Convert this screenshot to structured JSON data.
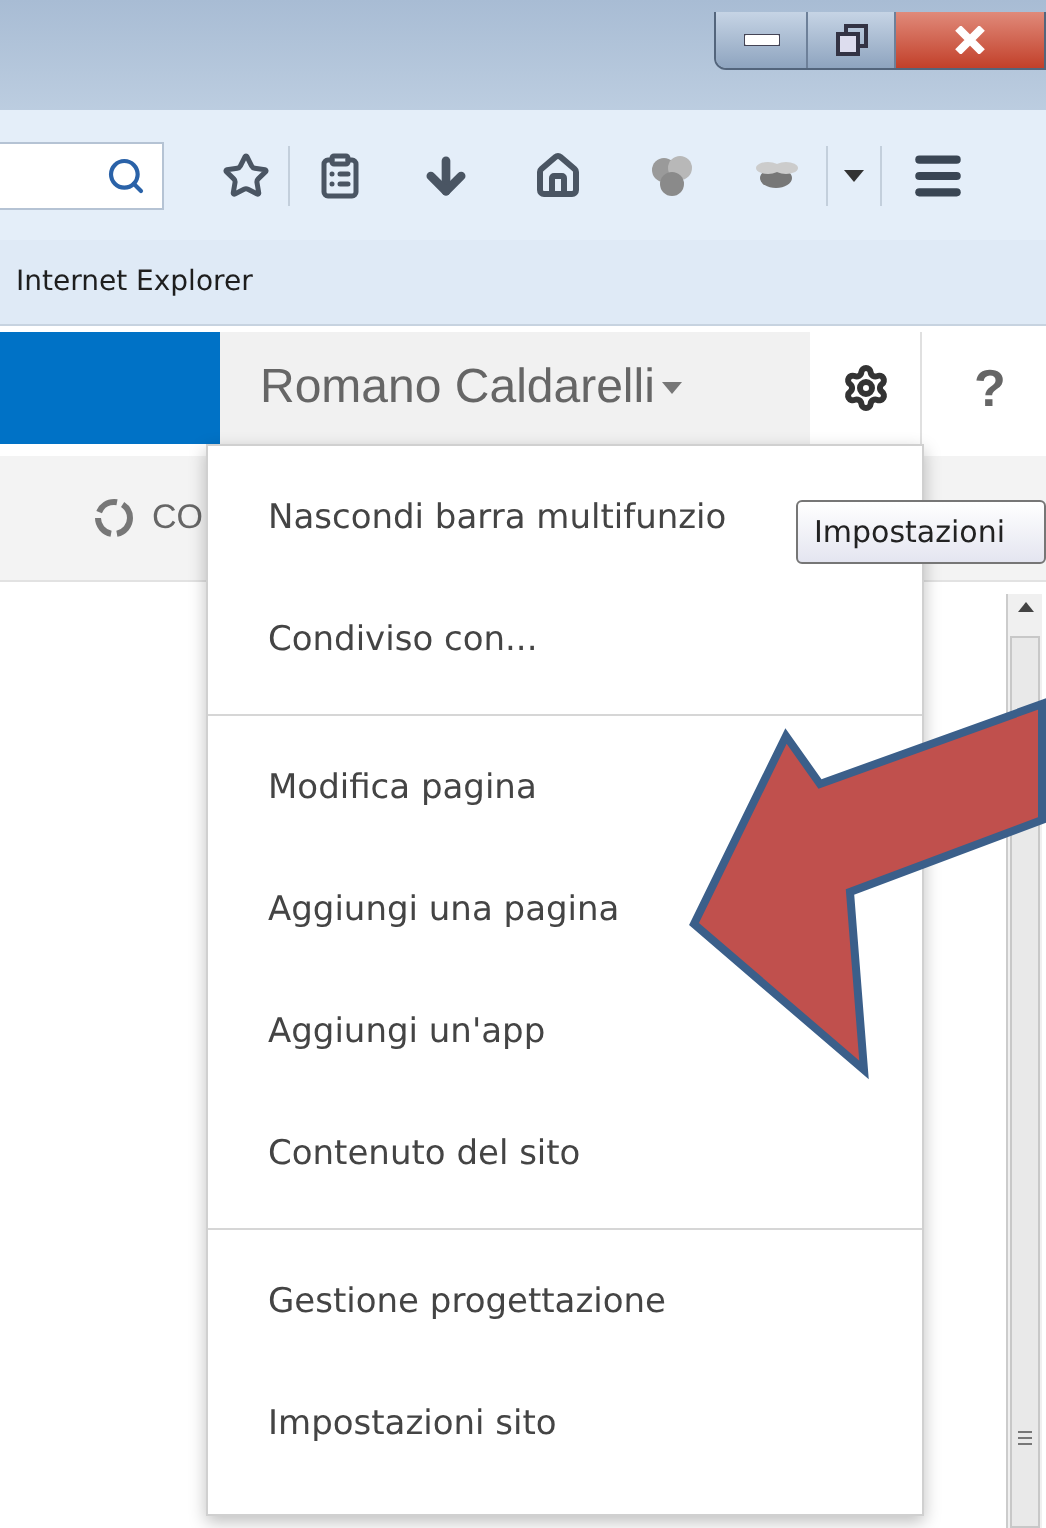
{
  "browser": {
    "bookmarks": [
      "Internet Explorer"
    ]
  },
  "suite_bar": {
    "user": "Romano Caldarelli",
    "help": "?"
  },
  "ribbon": {
    "label": "CO"
  },
  "menu": {
    "sections": [
      {
        "items": [
          "Nascondi barra multifunzio",
          "Condiviso con..."
        ]
      },
      {
        "items": [
          "Modifica pagina",
          "Aggiungi una pagina",
          "Aggiungi un'app",
          "Contenuto del sito"
        ]
      },
      {
        "items": [
          "Gestione progettazione",
          "Impostazioni sito"
        ]
      }
    ]
  },
  "tooltip": "Impostazioni"
}
